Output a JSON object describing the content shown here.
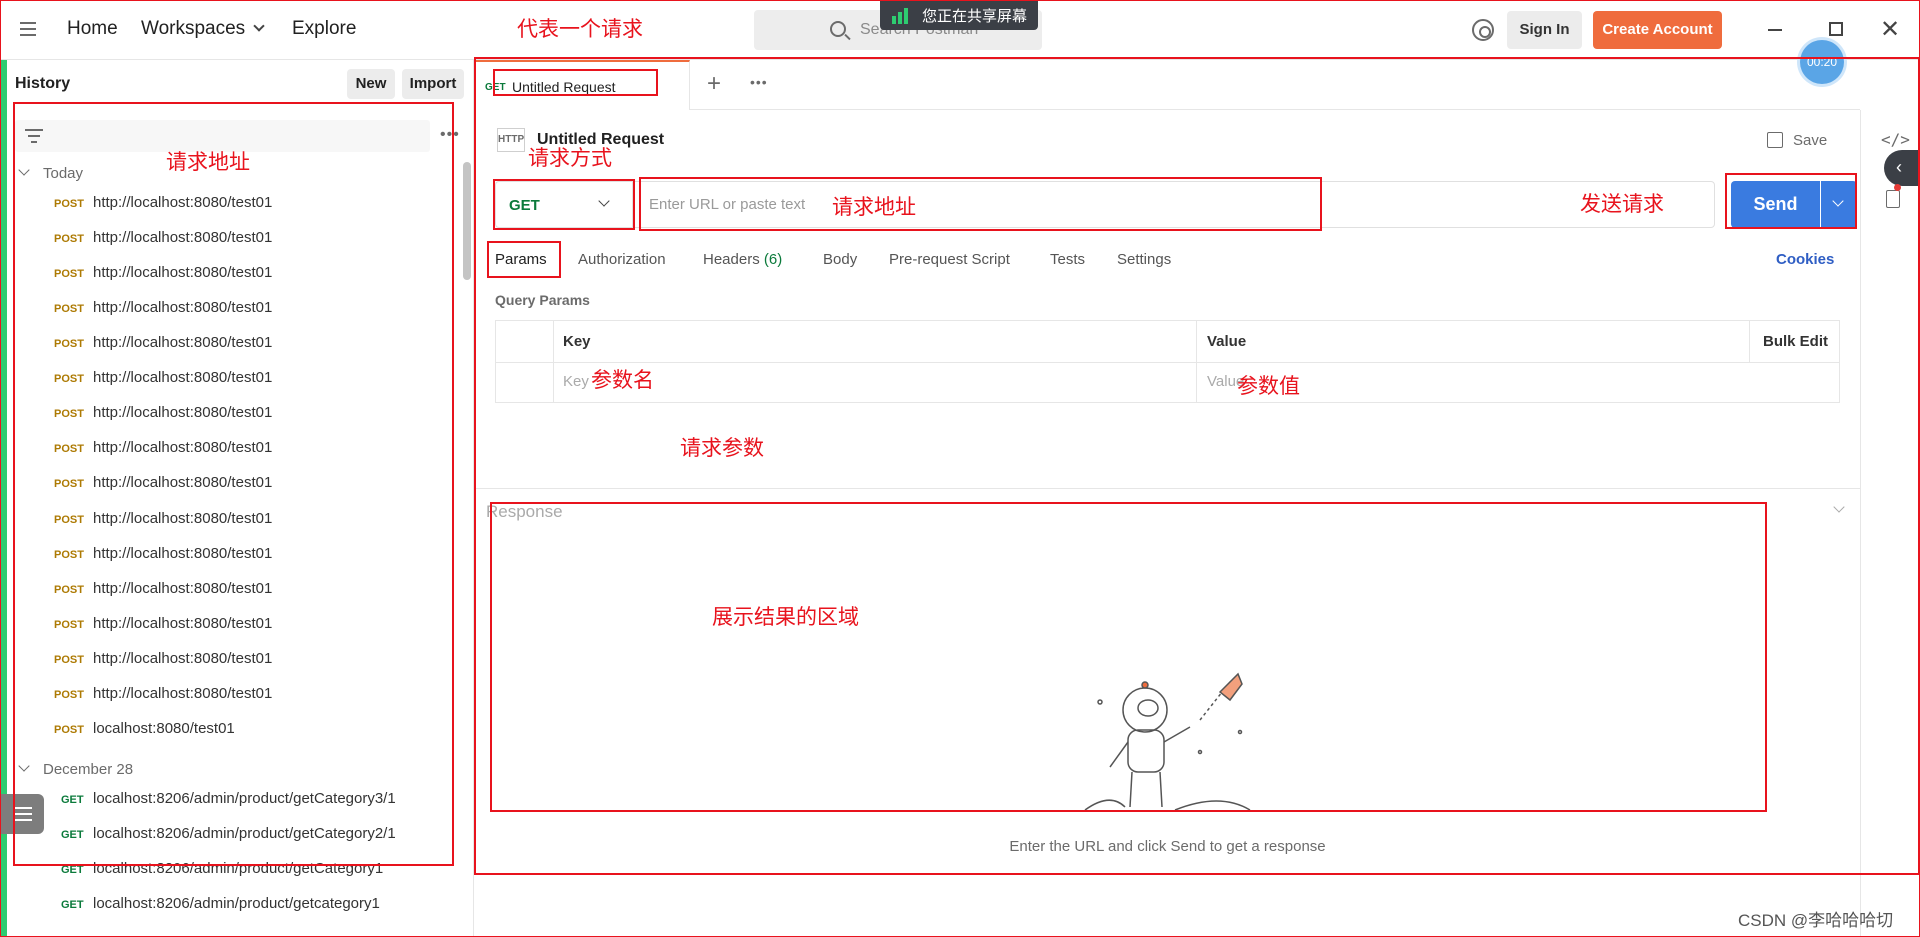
{
  "topbar": {
    "nav": [
      "Home",
      "Workspaces",
      "Explore"
    ],
    "search_placeholder": "Search Postman",
    "share_banner": "您正在共享屏幕",
    "signin": "Sign In",
    "create_account": "Create Account",
    "close": "✕"
  },
  "timer": "00:20",
  "sidebar": {
    "title": "History",
    "new_btn": "New",
    "import_btn": "Import",
    "groups": [
      {
        "label": "Today",
        "items": [
          {
            "method": "POST",
            "url": "http://localhost:8080/test01"
          },
          {
            "method": "POST",
            "url": "http://localhost:8080/test01"
          },
          {
            "method": "POST",
            "url": "http://localhost:8080/test01"
          },
          {
            "method": "POST",
            "url": "http://localhost:8080/test01"
          },
          {
            "method": "POST",
            "url": "http://localhost:8080/test01"
          },
          {
            "method": "POST",
            "url": "http://localhost:8080/test01"
          },
          {
            "method": "POST",
            "url": "http://localhost:8080/test01"
          },
          {
            "method": "POST",
            "url": "http://localhost:8080/test01"
          },
          {
            "method": "POST",
            "url": "http://localhost:8080/test01"
          },
          {
            "method": "POST",
            "url": "http://localhost:8080/test01"
          },
          {
            "method": "POST",
            "url": "http://localhost:8080/test01"
          },
          {
            "method": "POST",
            "url": "http://localhost:8080/test01"
          },
          {
            "method": "POST",
            "url": "http://localhost:8080/test01"
          },
          {
            "method": "POST",
            "url": "http://localhost:8080/test01"
          },
          {
            "method": "POST",
            "url": "http://localhost:8080/test01"
          },
          {
            "method": "POST",
            "url": "localhost:8080/test01"
          }
        ]
      },
      {
        "label": "December 28",
        "items": [
          {
            "method": "GET",
            "url": "localhost:8206/admin/product/getCategory3/1"
          },
          {
            "method": "GET",
            "url": "localhost:8206/admin/product/getCategory2/1"
          },
          {
            "method": "GET",
            "url": "localhost:8206/admin/product/getCategory1"
          },
          {
            "method": "GET",
            "url": "localhost:8206/admin/product/getcategory1"
          }
        ]
      }
    ]
  },
  "tab": {
    "method": "GET",
    "label": "Untitled Request"
  },
  "request": {
    "icon_text": "HTTP",
    "name": "Untitled Request",
    "save": "Save",
    "method": "GET",
    "url_placeholder": "Enter URL or paste text",
    "url_value": "",
    "send": "Send"
  },
  "subtabs": {
    "params": "Params",
    "authorization": "Authorization",
    "headers": "Headers",
    "headers_count": "(6)",
    "body": "Body",
    "prerequest": "Pre-request Script",
    "tests": "Tests",
    "settings": "Settings",
    "cookies": "Cookies"
  },
  "query_params": {
    "title": "Query Params",
    "col_key": "Key",
    "col_value": "Value",
    "bulk_edit": "Bulk Edit",
    "key_placeholder": "Key",
    "value_placeholder": "Value"
  },
  "response": {
    "label": "Response",
    "empty_message": "Enter the URL and click Send to get a response"
  },
  "annotations": {
    "represents_request": "代表一个请求",
    "request_url_sidebar": "请求地址",
    "request_method": "请求方式",
    "request_url": "请求地址",
    "send_request": "发送请求",
    "param_name": "参数名",
    "param_value": "参数值",
    "request_params": "请求参数",
    "result_area": "展示结果的区域"
  },
  "watermark": "CSDN @李哈哈哈切",
  "colors": {
    "accent": "#ef6c3d",
    "send": "#3a7be0",
    "annotation": "#e8131d",
    "share_green": "#2ecc71"
  }
}
